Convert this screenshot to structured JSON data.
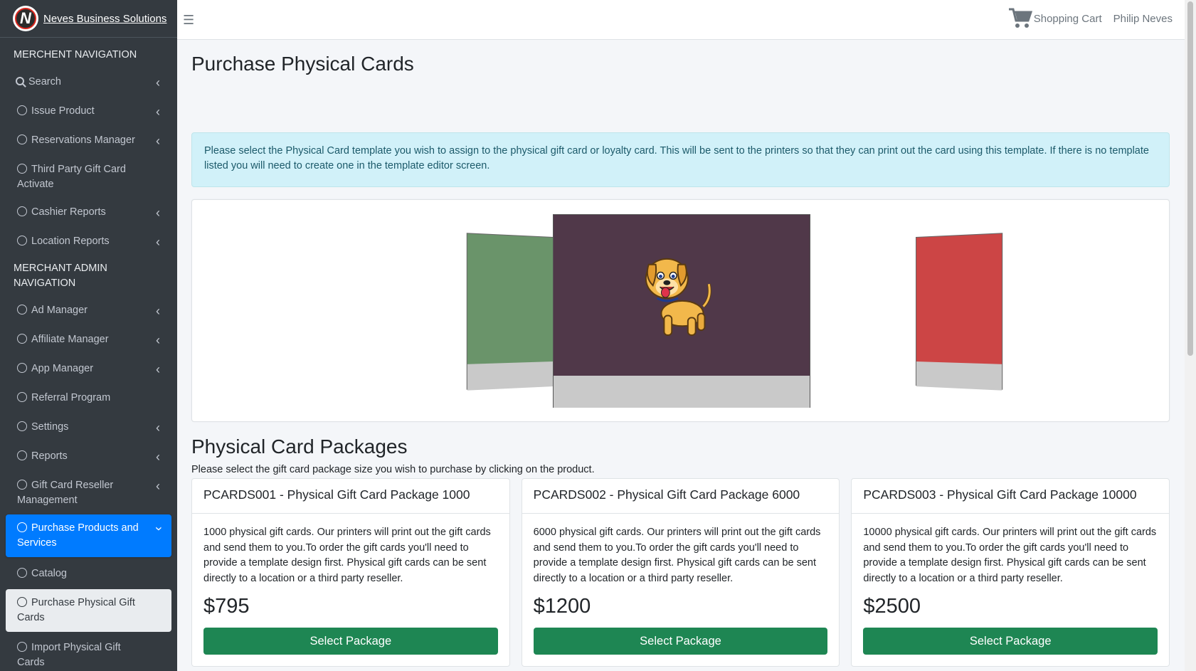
{
  "brand": {
    "name": "Neves Business Solutions",
    "logo_letter": "N"
  },
  "topbar": {
    "cart_label": "Shopping Cart",
    "user_name": "Philip Neves"
  },
  "sidebar": {
    "header1": "MERCHENT NAVIGATION",
    "items1": [
      {
        "label": "Search"
      },
      {
        "label": "Issue Product"
      },
      {
        "label": "Reservations Manager"
      },
      {
        "label": "Third Party Gift Card Activate"
      },
      {
        "label": "Cashier Reports"
      },
      {
        "label": "Location Reports"
      }
    ],
    "header2": "MERCHANT ADMIN NAVIGATION",
    "items2": [
      {
        "label": "Ad Manager"
      },
      {
        "label": "Affiliate Manager"
      },
      {
        "label": "App Manager"
      },
      {
        "label": "Referral Program"
      },
      {
        "label": "Settings"
      },
      {
        "label": "Reports"
      },
      {
        "label": "Gift Card Reseller Management"
      },
      {
        "label": "Purchase Products and Services"
      },
      {
        "label": "Catalog"
      },
      {
        "label": "Purchase Physical Gift Cards"
      },
      {
        "label": "Import Physical Gift Cards"
      }
    ]
  },
  "main": {
    "title": "Purchase Physical Cards",
    "alert": "Please select the Physical Card template you wish to assign to the physical gift card or loyalty card. This will be sent to the printers so that they can print out the card using this template. If there is no template listed you will need to create one in the template editor screen.",
    "packages_title": "Physical Card Packages",
    "packages_subtitle": "Please select the gift card package size you wish to purchase by clicking on the product.",
    "packages": [
      {
        "title": "PCARDS001 - Physical Gift Card Package 1000",
        "description": "1000 physical gift cards. Our printers will print out the gift cards and send them to you.To order the gift cards you'll need to provide a template design first. Physical gift cards can be sent directly to a location or a third party reseller.",
        "price": "$795",
        "button": "Select Package"
      },
      {
        "title": "PCARDS002 - Physical Gift Card Package 6000",
        "description": "6000 physical gift cards. Our printers will print out the gift cards and send them to you.To order the gift cards you'll need to provide a template design first. Physical gift cards can be sent directly to a location or a third party reseller.",
        "price": "$1200",
        "button": "Select Package"
      },
      {
        "title": "PCARDS003 - Physical Gift Card Package 10000",
        "description": "10000 physical gift cards. Our printers will print out the gift cards and send them to you.To order the gift cards you'll need to provide a template design first. Physical gift cards can be sent directly to a location or a third party reseller.",
        "price": "$2500",
        "button": "Select Package"
      }
    ]
  },
  "colors": {
    "sidebar_bg": "#343a40",
    "active_blue": "#007bff",
    "button_green": "#1e8653",
    "alert_bg": "#d1f1f9"
  }
}
